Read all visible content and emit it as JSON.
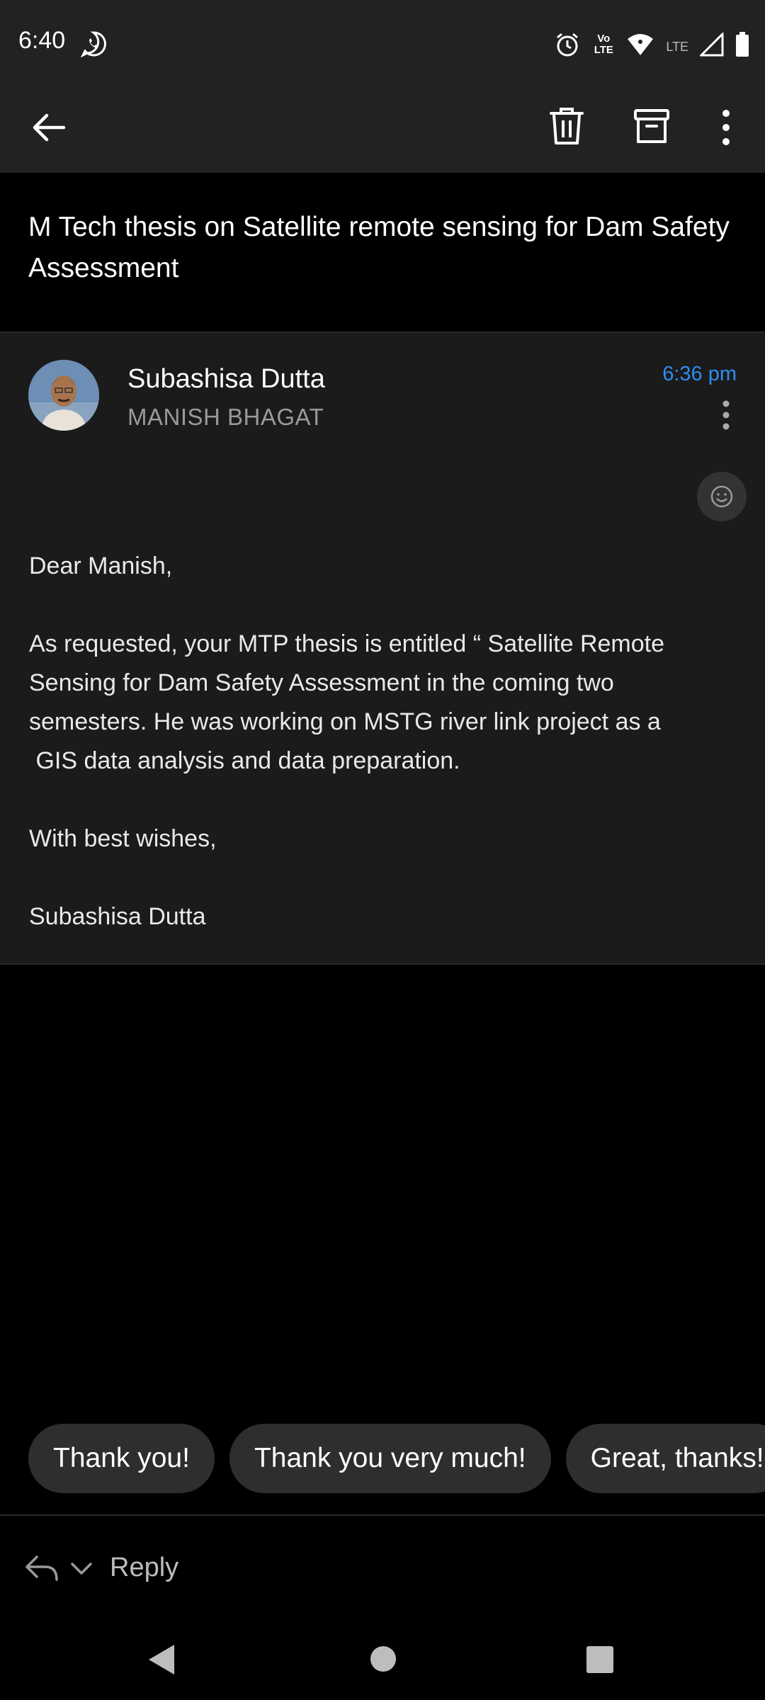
{
  "status_bar": {
    "time": "6:40",
    "icons": [
      "whatsapp-icon",
      "alarm-icon",
      "volte-icon",
      "wifi-icon",
      "lte-icon",
      "signal-icon",
      "battery-icon"
    ],
    "network_label": "LTE",
    "volte_label": "Vo LTE"
  },
  "app_bar": {
    "icons": [
      "back-arrow-icon",
      "delete-icon",
      "archive-icon",
      "more-vert-icon"
    ]
  },
  "subject": "M Tech thesis on Satellite remote sensing for Dam Safety Assessment",
  "message": {
    "sender": "Subashisa Dutta",
    "recipient": "MANISH BHAGAT",
    "time": "6:36 pm",
    "body": {
      "greeting": "Dear Manish,",
      "line1": "As requested, your MTP thesis is entitled “ Satellite Remote",
      "line2": "Sensing for Dam Safety Assessment in the coming two",
      "line3": "semesters. He was working on MSTG river link project as a",
      "line4": " GIS data analysis and data preparation.",
      "closing": "With best wishes,",
      "signature": "Subashisa Dutta"
    }
  },
  "smart_replies": [
    "Thank you!",
    "Thank you very much!",
    "Great, thanks!"
  ],
  "reply_bar": {
    "label": "Reply"
  },
  "colors": {
    "accent": "#2e8df0",
    "background": "#000000",
    "card": "#1b1b1b",
    "bar": "#222222"
  }
}
